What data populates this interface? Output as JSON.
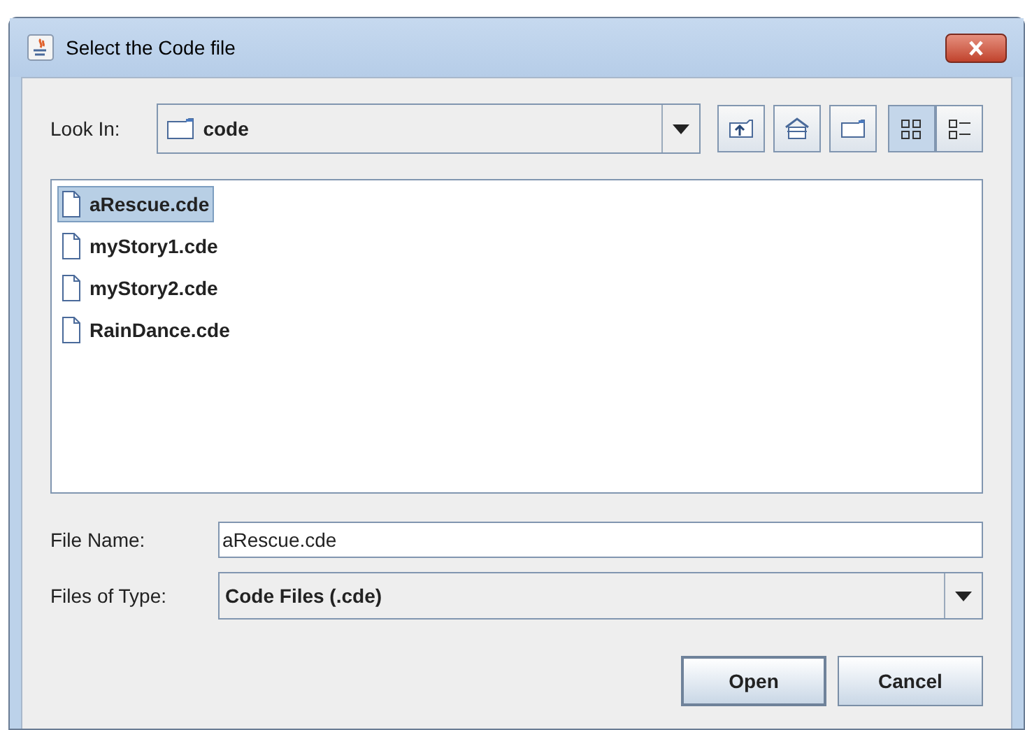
{
  "window": {
    "title": "Select the Code file"
  },
  "look_in": {
    "label": "Look In:",
    "value": "code"
  },
  "toolbar": [
    {
      "kind": "up"
    },
    {
      "kind": "home"
    },
    {
      "kind": "new-folder"
    }
  ],
  "view_buttons": [
    {
      "kind": "list",
      "selected": true
    },
    {
      "kind": "details",
      "selected": false
    }
  ],
  "files": [
    {
      "name": "aRescue.cde",
      "selected": true
    },
    {
      "name": "myStory1.cde",
      "selected": false
    },
    {
      "name": "myStory2.cde",
      "selected": false
    },
    {
      "name": "RainDance.cde",
      "selected": false
    }
  ],
  "file_name": {
    "label": "File Name:",
    "value": "aRescue.cde"
  },
  "file_type": {
    "label": "Files of Type:",
    "value": "Code Files (.cde)"
  },
  "buttons": [
    "Open",
    "Cancel"
  ]
}
